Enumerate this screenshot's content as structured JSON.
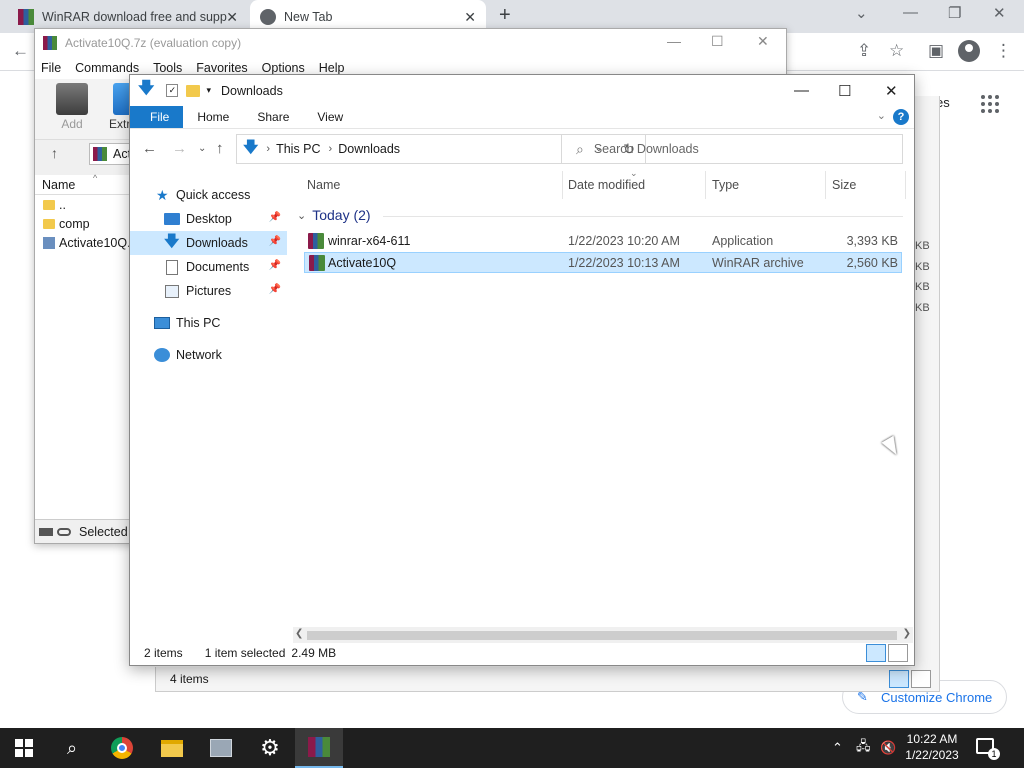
{
  "chrome": {
    "tabs": [
      {
        "title": "WinRAR download free and supp",
        "close": "✕"
      },
      {
        "title": "New Tab",
        "close": "✕"
      }
    ],
    "new_tab": "+",
    "partial_link": "es",
    "customize_label": "Customize Chrome"
  },
  "winrar": {
    "title": "Activate10Q.7z (evaluation copy)",
    "menu": [
      "File",
      "Commands",
      "Tools",
      "Favorites",
      "Options",
      "Help"
    ],
    "tools": [
      {
        "label": "Add"
      },
      {
        "label": "Extra"
      }
    ],
    "address_partial": "Act",
    "list_header": "Name",
    "rows": [
      {
        "name": ".."
      },
      {
        "name": "comp"
      },
      {
        "name": "Activate10Q.c"
      }
    ],
    "status": "Selected"
  },
  "background_explorer": {
    "status": "4 items",
    "kb_labels": [
      "KB",
      "KB",
      "KB",
      "KB"
    ]
  },
  "explorer": {
    "title": "Downloads",
    "ribbon_tabs": [
      "File",
      "Home",
      "Share",
      "View"
    ],
    "help": "?",
    "breadcrumb": [
      "This PC",
      "Downloads"
    ],
    "search_placeholder": "Search Downloads",
    "sidebar": [
      {
        "label": "Quick access",
        "pinned": false
      },
      {
        "label": "Desktop",
        "pinned": true
      },
      {
        "label": "Downloads",
        "pinned": true
      },
      {
        "label": "Documents",
        "pinned": true
      },
      {
        "label": "Pictures",
        "pinned": true
      },
      {
        "label": "This PC",
        "pinned": false
      },
      {
        "label": "Network",
        "pinned": false
      }
    ],
    "columns": [
      "Name",
      "Date modified",
      "Type",
      "Size"
    ],
    "group_label": "Today (2)",
    "files": [
      {
        "name": "winrar-x64-611",
        "date": "1/22/2023 10:20 AM",
        "type": "Application",
        "size": "3,393 KB"
      },
      {
        "name": "Activate10Q",
        "date": "1/22/2023 10:13 AM",
        "type": "WinRAR archive",
        "size": "2,560 KB"
      }
    ],
    "status": {
      "items": "2 items",
      "selected": "1 item selected",
      "size": "2.49 MB"
    }
  },
  "taskbar": {
    "time": "10:22 AM",
    "date": "1/22/2023",
    "notifications": "1"
  },
  "colors": {
    "accent": "#1979ca",
    "selection": "#cce8ff",
    "taskbar": "#1f1f1f"
  }
}
